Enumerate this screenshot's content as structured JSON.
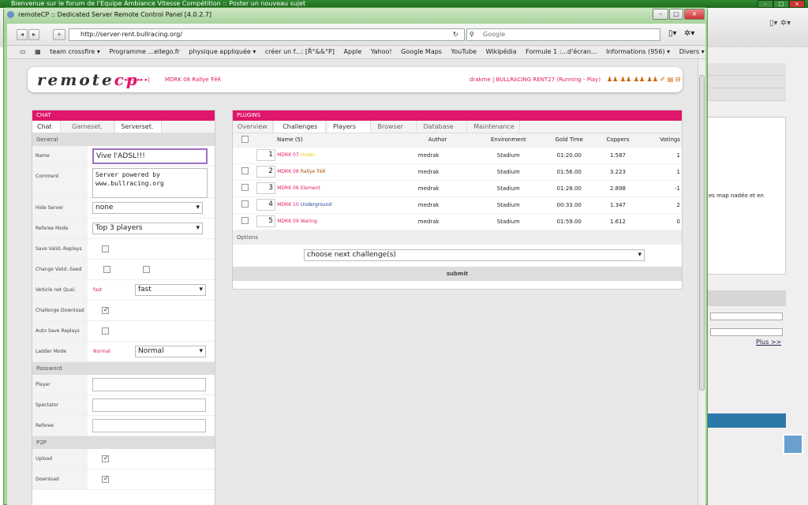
{
  "bg_window": {
    "title": "Bienvenue sur le forum de l'Equipe Ambiance Vitesse Compétition :: Poster un nouveau sujet",
    "side_text": "es map nadéo et en",
    "plus_link": "Plus >>"
  },
  "window": {
    "title": "remoteCP :: Dedicated Server Remote Control Panel [4.0.2.7]"
  },
  "browser": {
    "url": "http://server-rent.bullracing.org/",
    "search_placeholder": "Google",
    "bookmarks": [
      "team crossfire ▾",
      "Programme ...ellego.fr",
      "physique appliquée ▾",
      "créer un f...: [Ř°&&°P]",
      "Apple",
      "Yahoo!",
      "Google Maps",
      "YouTube",
      "Wikipédia",
      "Formule 1 :...d'écran...",
      "Informations (956) ▾",
      "Divers ▾"
    ]
  },
  "header": {
    "logo_a": "remote",
    "logo_b": "cp",
    "nav_server": "MDRK 08 Rallye ŦēЌ",
    "user_status": "drakme | BULLRACING RENT27 (Running - Play)"
  },
  "chat": {
    "title": "CHAT",
    "tabs": [
      "Chat",
      "Gameset.",
      "Serverset."
    ],
    "sections": {
      "general": "General",
      "password": "Password",
      "p2p": "P2P"
    },
    "labels": {
      "name": "Name",
      "comment": "Comment",
      "hide_server": "Hide Server",
      "referee_mode": "Referee Mode",
      "save_replays": "Save Valid.-Replays",
      "change_seed": "Change Valid.-Seed",
      "vehicle_net": "Vehicle net Qual.",
      "challenge_download": "Challenge Download",
      "auto_save": "Auto Save Replays",
      "ladder_mode": "Ladder Mode",
      "player": "Player",
      "spectator": "Spectator",
      "referee": "Referee",
      "upload": "Upload",
      "download": "Download"
    },
    "values": {
      "name": "Vive l'ADSL!!!",
      "comment_line1": "Server powered by",
      "comment_line2": "www.bullracing.org",
      "hide_server": "none",
      "referee_mode": "Top 3 players",
      "vehicle_hint": "fast",
      "vehicle": "fast",
      "ladder_hint": "Normal",
      "ladder": "Normal"
    }
  },
  "plugins": {
    "title": "PLUGINS",
    "tabs": [
      "Overview",
      "Challenges",
      "Players",
      "Browser",
      "Database",
      "Maintenance"
    ],
    "columns": [
      "Name (5)",
      "Author",
      "Environment",
      "Gold Time",
      "Coppers",
      "Votings"
    ],
    "rows": [
      {
        "num": "1",
        "prefix": "MDRK 07",
        "name": "Under...",
        "author": "medrak",
        "env": "Stadium",
        "gold": "01:20.00",
        "coppers": "1.587",
        "votes": "1"
      },
      {
        "num": "2",
        "prefix": "MDRK 08",
        "name": "Rallye ŦēЌ",
        "author": "medrak",
        "env": "Stadium",
        "gold": "01:56.00",
        "coppers": "3.223",
        "votes": "1"
      },
      {
        "num": "3",
        "prefix": "MDRK 06",
        "name": "Element",
        "author": "medrak",
        "env": "Stadium",
        "gold": "01:28.00",
        "coppers": "2.898",
        "votes": "-1"
      },
      {
        "num": "4",
        "prefix": "MDRK 10",
        "name": "Underground",
        "author": "medrak",
        "env": "Stadium",
        "gold": "00:33.00",
        "coppers": "1.347",
        "votes": "2"
      },
      {
        "num": "5",
        "prefix": "MDRK 09",
        "name": "Waŕing",
        "author": "medrak",
        "env": "Stadium",
        "gold": "01:59.00",
        "coppers": "1.612",
        "votes": "0"
      }
    ],
    "options_label": "Options",
    "next_select": "choose next challenge(s)",
    "submit": "submit"
  },
  "colors": {
    "accent": "#e0166a",
    "window_frame": "#a9d49d"
  }
}
